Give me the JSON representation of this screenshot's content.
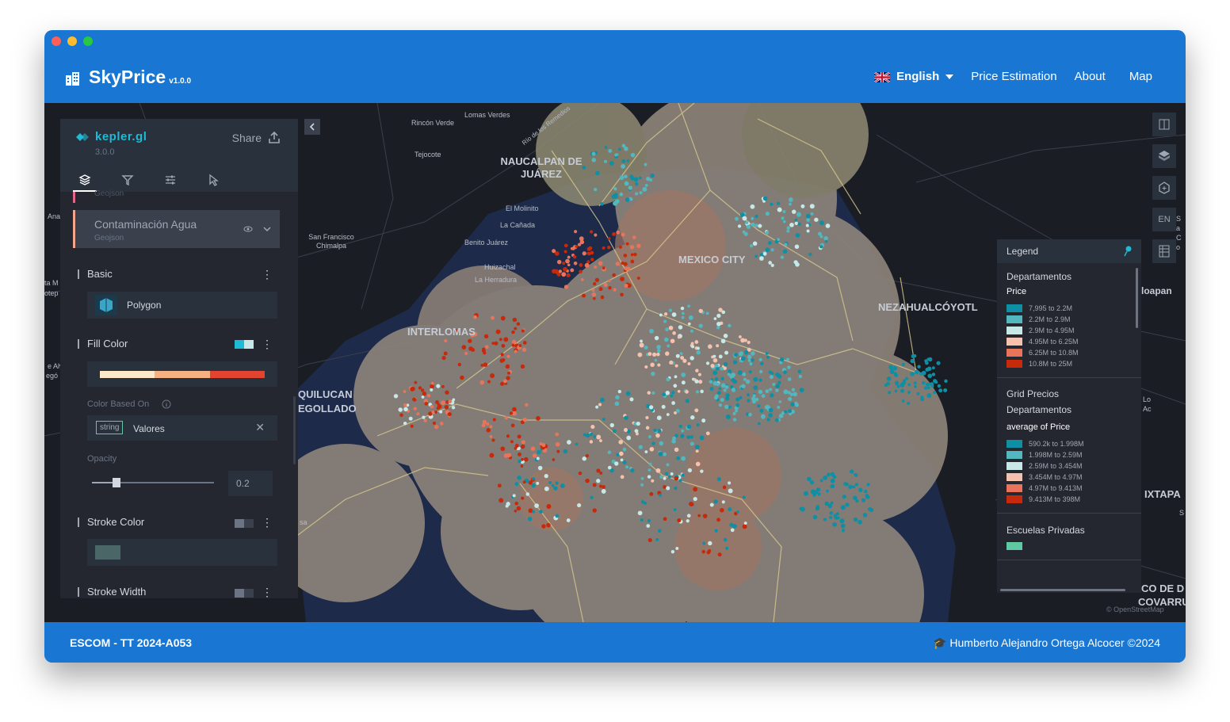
{
  "window": {
    "dots": [
      "#ff5f57",
      "#febc2e",
      "#28c840"
    ]
  },
  "navbar": {
    "brand": "SkyPrice",
    "version": "v1.0.0",
    "language": "English",
    "links": [
      "Price Estimation",
      "About",
      "Map"
    ]
  },
  "footer": {
    "left": "ESCOM - TT 2024-A053",
    "right": "🎓 Humberto Alejandro Ortega Alcocer ©2024"
  },
  "kepler": {
    "logo": "kepler.gl",
    "version": "3.0.0",
    "share": "Share",
    "tabs": [
      "layers-icon",
      "filter-icon",
      "settings-icon",
      "interaction-icon"
    ],
    "prev_layer_sub": "Geojson",
    "layer": {
      "name": "Contaminación Agua",
      "type": "Geojson"
    },
    "basic": {
      "title": "Basic",
      "layer_type": "Polygon"
    },
    "fill": {
      "title": "Fill Color",
      "ramp": [
        "#fde8c9",
        "#f6b183",
        "#e2442f"
      ],
      "color_based_on_label": "Color Based On",
      "type_badge": "string",
      "field": "Valores",
      "opacity_label": "Opacity",
      "opacity": 0.2
    },
    "stroke_color": {
      "title": "Stroke Color",
      "color": "#4b6666"
    },
    "stroke_width": {
      "title": "Stroke Width"
    }
  },
  "map_controls": [
    "split-map-icon",
    "3d-map-icon",
    "draw-icon",
    "EN",
    "legend-table-icon"
  ],
  "legend": {
    "title": "Legend",
    "sections": [
      {
        "name": "Departamentos",
        "field": "Price",
        "items": [
          {
            "color": "#0e8fa3",
            "label": "7,995 to 2.2M"
          },
          {
            "color": "#52b7be",
            "label": "2.2M to 2.9M"
          },
          {
            "color": "#c7e8e6",
            "label": "2.9M to 4.95M"
          },
          {
            "color": "#f6c2ae",
            "label": "4.95M to 6.25M"
          },
          {
            "color": "#e8755b",
            "label": "6.25M to 10.8M"
          },
          {
            "color": "#c7290b",
            "label": "10.8M to 25M"
          }
        ]
      },
      {
        "name": "Grid Precios Departamentos",
        "field": "average of Price",
        "items": [
          {
            "color": "#0e8fa3",
            "label": "590.2k to 1.998M"
          },
          {
            "color": "#52b7be",
            "label": "1.998M to 2.59M"
          },
          {
            "color": "#c7e8e6",
            "label": "2.59M to 3.454M"
          },
          {
            "color": "#f6c2ae",
            "label": "3.454M to 4.97M"
          },
          {
            "color": "#e8755b",
            "label": "4.97M to 9.413M"
          },
          {
            "color": "#c7290b",
            "label": "9.413M to 398M"
          }
        ]
      },
      {
        "name": "Escuelas Privadas",
        "field": "",
        "items": [
          {
            "color": "#5fc9a3",
            "label": ""
          }
        ]
      }
    ]
  },
  "map_labels": {
    "naucalpan": "NAUCALPAN DE JUÁREZ",
    "mexico_city": "MEXICO CITY",
    "nezahualcoyotl": "NEZAHUALCÓYOTL",
    "interlomas": "INTERLOMAS",
    "quilucan": "QUILUCAN",
    "egollado": "EGOLLADO",
    "ixtapa": "IXTAPA",
    "covarrubias": "COVARRUBI",
    "co_de": "CO DE D",
    "sa_co": "Sa Co",
    "loapan": "loapan",
    "rincon_verde": "Rincón Verde",
    "lomas_verdes": "Lomas Verdes",
    "tejocote": "Tejocote",
    "el_molinito": "El Molinito",
    "la_canada": "La Cañada",
    "benito_juarez": "Benito Juárez",
    "huizachal": "Huizachal",
    "la_herradura": "La Herradura",
    "san_francisco": "San Francisco Chimalpa",
    "rio_remedios": "Río de los Remedios",
    "la": "La",
    "ana": "Ana",
    "ta_m": "ta M",
    "otep": "otep",
    "e_alv": "e Alv",
    "ego": "egó",
    "sa": "sa",
    "lo_ac": "Lo Ac",
    "s": "S",
    "osm": "© OpenStreetMap"
  }
}
